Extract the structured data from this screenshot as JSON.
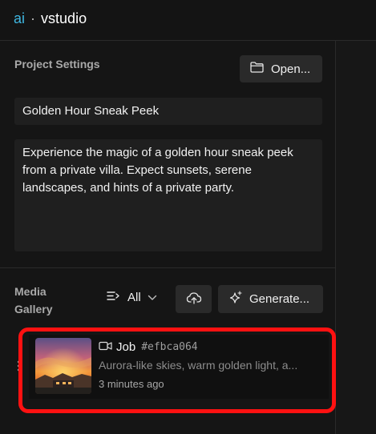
{
  "brand": {
    "ai": "ai",
    "separator": "·",
    "name": "vstudio"
  },
  "project_settings": {
    "title": "Project Settings",
    "open_button": "Open...",
    "project_name": "Golden Hour Sneak Peek",
    "description": "Experience the magic of a golden hour sneak peek from a private villa. Expect sunsets, serene landscapes, and hints of a private party."
  },
  "media_gallery": {
    "title": "Media Gallery",
    "filter_value": "All",
    "generate_button": "Generate...",
    "items": [
      {
        "type_label": "Job",
        "job_id": "#efbca064",
        "description": "Aurora-like skies, warm golden light, a...",
        "time": "3 minutes ago",
        "icon": "video-camera-icon"
      }
    ]
  },
  "colors": {
    "accent": "#3fb6e0",
    "highlight": "#ff1111",
    "background": "#141414",
    "surface": "#1f1f1f",
    "button": "#2a2a2a"
  }
}
